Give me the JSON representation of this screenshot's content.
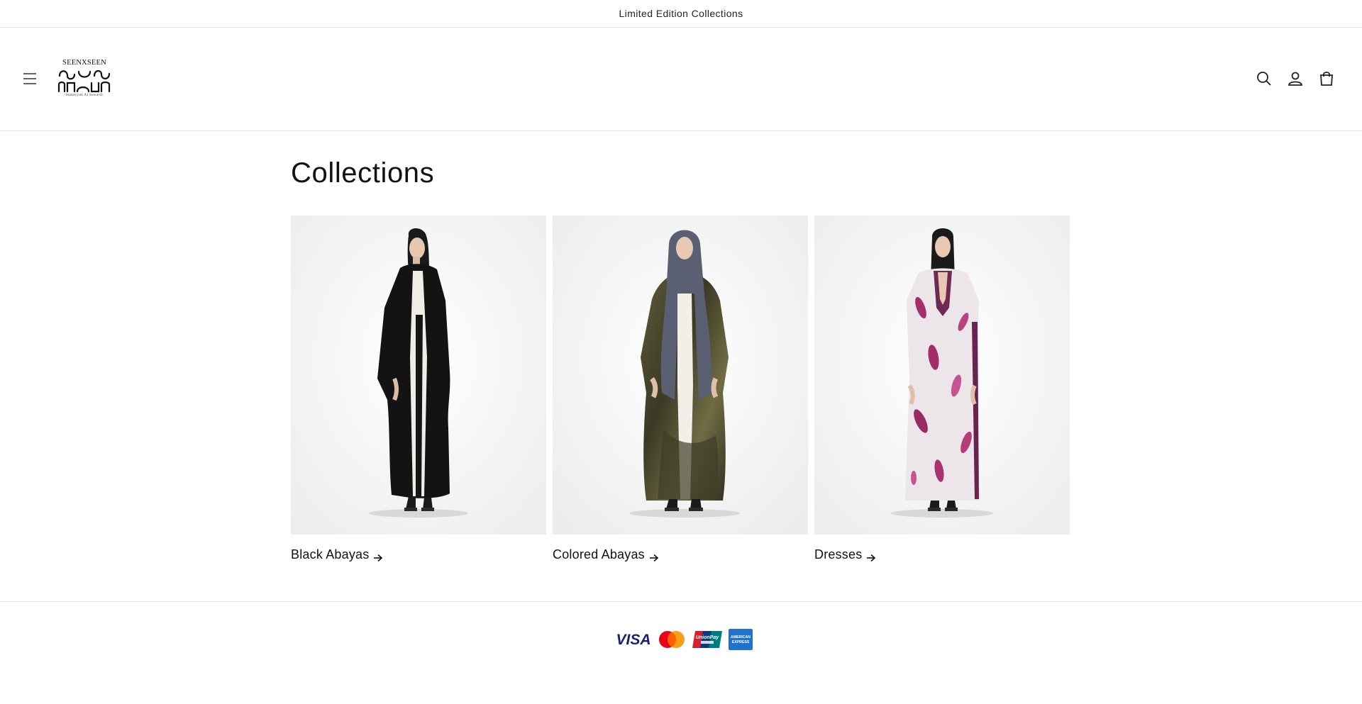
{
  "announcement": {
    "text": "Limited Edition Collections"
  },
  "header": {
    "logo": {
      "top_text": "SEENXSEEN",
      "bottom_text": "Sumayyah Al Suwaidi"
    },
    "icons": [
      "hamburger-menu-icon",
      "search-icon",
      "account-icon",
      "cart-icon"
    ]
  },
  "main": {
    "title": "Collections",
    "collections": [
      {
        "label": "Black Abayas",
        "image": "woman in black abaya",
        "dress_color": "#141414"
      },
      {
        "label": "Colored Abayas",
        "image": "woman in olive camouflage abaya with grey hood",
        "dress_color": "#4a4a2c"
      },
      {
        "label": "Dresses",
        "image": "woman in white dress with magenta floral print",
        "dress_color": "#e9e1e5"
      }
    ]
  },
  "footer": {
    "payment_methods": [
      {
        "name": "Visa",
        "label": "VISA"
      },
      {
        "name": "Mastercard",
        "label": ""
      },
      {
        "name": "UnionPay",
        "label": "UnionPay"
      },
      {
        "name": "American Express",
        "label": "AMERICAN EXPRESS"
      }
    ]
  },
  "colors": {
    "text": "#121212",
    "border": "#e6e6e6",
    "background": "#ffffff"
  }
}
